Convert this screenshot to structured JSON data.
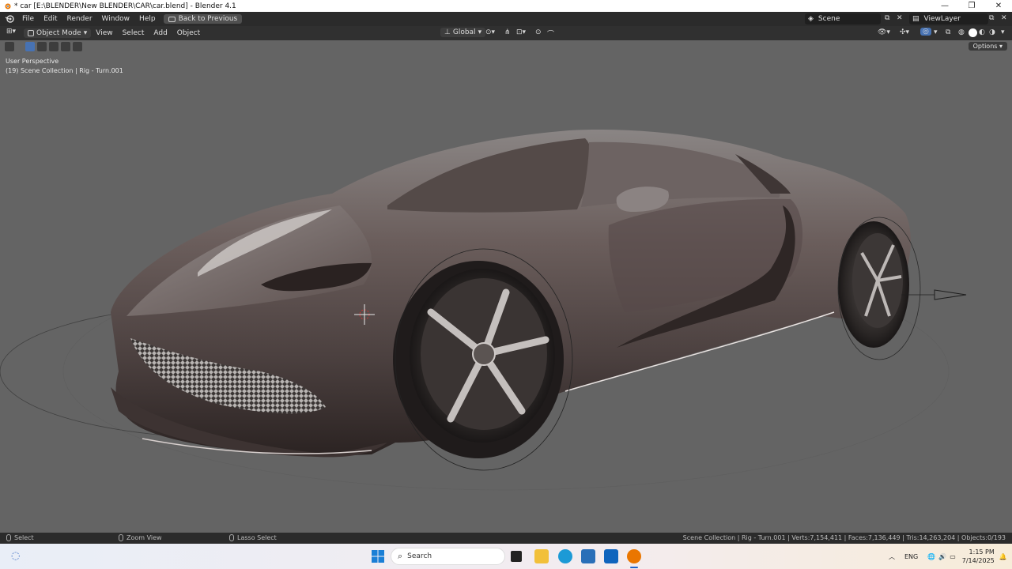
{
  "window": {
    "title": "* car [E:\\BLENDER\\New BLENDER\\CAR\\car.blend] - Blender 4.1",
    "controls": [
      "—",
      "❐",
      "✕"
    ]
  },
  "topbar": {
    "menus": [
      "File",
      "Edit",
      "Render",
      "Window",
      "Help"
    ],
    "back_button": "Back to Previous",
    "scene": "Scene",
    "view_layer": "ViewLayer"
  },
  "header3d": {
    "mode": "Object Mode",
    "menus": [
      "View",
      "Select",
      "Add",
      "Object"
    ],
    "orientation": "Global"
  },
  "viewport": {
    "perspective": "User Perspective",
    "collection_info": "(19) Scene Collection | Rig - Turn.001",
    "options_label": "Options",
    "background_color": "#646464"
  },
  "statusbar": {
    "select": "Select",
    "zoom_view": "Zoom View",
    "lasso_select": "Lasso Select",
    "stats": "Scene Collection | Rig - Turn.001 | Verts:7,154,411 | Faces:7,136,449 | Tris:14,263,204 | Objects:0/193"
  },
  "taskbar": {
    "search_placeholder": "Search",
    "language": "ENG",
    "time": "1:15 PM",
    "date": "7/14/2025"
  }
}
